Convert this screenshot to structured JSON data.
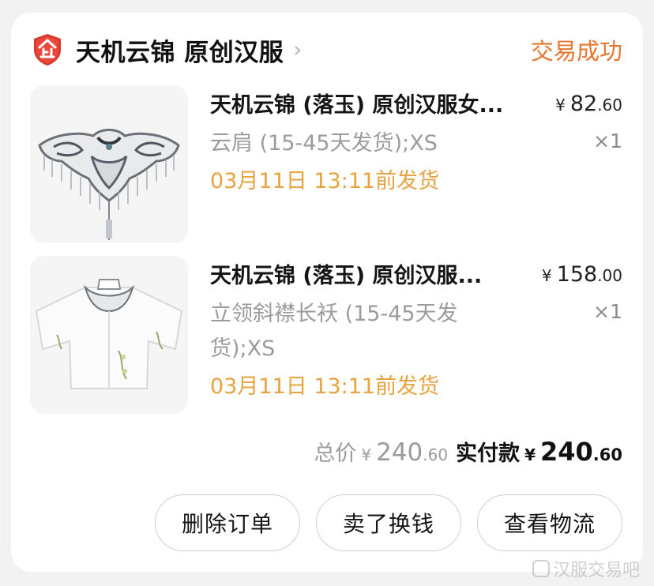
{
  "shop": {
    "name": "天机云锦 原创汉服",
    "icon": "shop-badge-icon",
    "order_status": "交易成功"
  },
  "items": [
    {
      "title": "天机云锦 (落玉) 原创汉服女...",
      "sku": "云肩 (15-45天发货);XS",
      "ship_by": "03月11日 13:11前发货",
      "price_yen": "¥",
      "price_int": "82",
      "price_dec": ".60",
      "qty": "×1"
    },
    {
      "title": "天机云锦 (落玉) 原创汉服...",
      "sku": "立领斜襟长袄 (15-45天发货);XS",
      "ship_by": "03月11日 13:11前发货",
      "price_yen": "¥",
      "price_int": "158",
      "price_dec": ".00",
      "qty": "×1"
    }
  ],
  "totals": {
    "total_label": "总价",
    "total_yen": "¥",
    "total_int": "240",
    "total_dec": ".60",
    "paid_label": "实付款",
    "paid_yen": "¥",
    "paid_int": "240",
    "paid_dec": ".60"
  },
  "actions": {
    "delete": "删除订单",
    "resell": "卖了换钱",
    "logistics": "查看物流"
  },
  "colors": {
    "status": "#e8752e",
    "ship": "#e8a23e",
    "badge": "#d9382c"
  },
  "watermark": "汉服交易吧"
}
